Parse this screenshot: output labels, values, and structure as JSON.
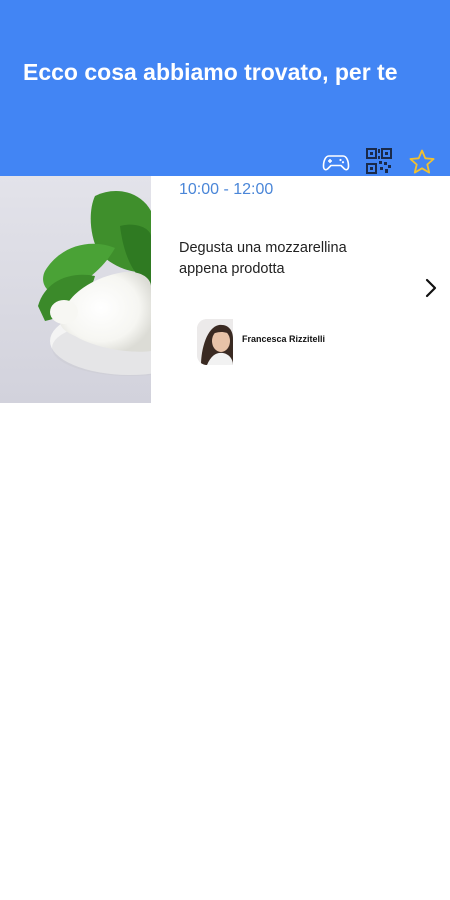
{
  "header": {
    "title": "Ecco cosa abbiamo trovato, per te",
    "background_color": "#4285f4",
    "icons": [
      "gamepad-icon",
      "qr-code-icon",
      "star-icon"
    ]
  },
  "event": {
    "time": "10:00 - 12:00",
    "description": "Degusta una mozzarellina appena prodotta",
    "image": "mozzarella-with-basil-photo",
    "host": {
      "name": "Francesca Rizzitelli"
    },
    "time_color": "#4a86d8"
  }
}
